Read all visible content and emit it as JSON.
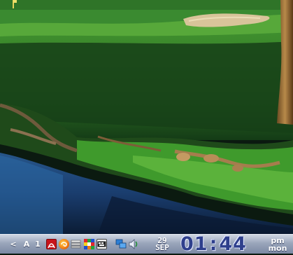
{
  "taskbar": {
    "arrow": "<",
    "ime_label": "A",
    "count_label": "1"
  },
  "tray_icons": [
    "acrobat-icon",
    "swirl-icon",
    "disk-stack-icon",
    "color-grid-icon",
    "kb-icon",
    "network-icon",
    "volume-icon"
  ],
  "clock": {
    "day": "29",
    "month": "SEP",
    "hours": "01",
    "separator": ":",
    "minutes": "44",
    "ampm": "pm",
    "weekday": "mon"
  },
  "colors": {
    "taskbar_top": "#cfd6e2",
    "taskbar_bottom": "#7b88a3",
    "clock_digits": "#2e3f8c"
  }
}
